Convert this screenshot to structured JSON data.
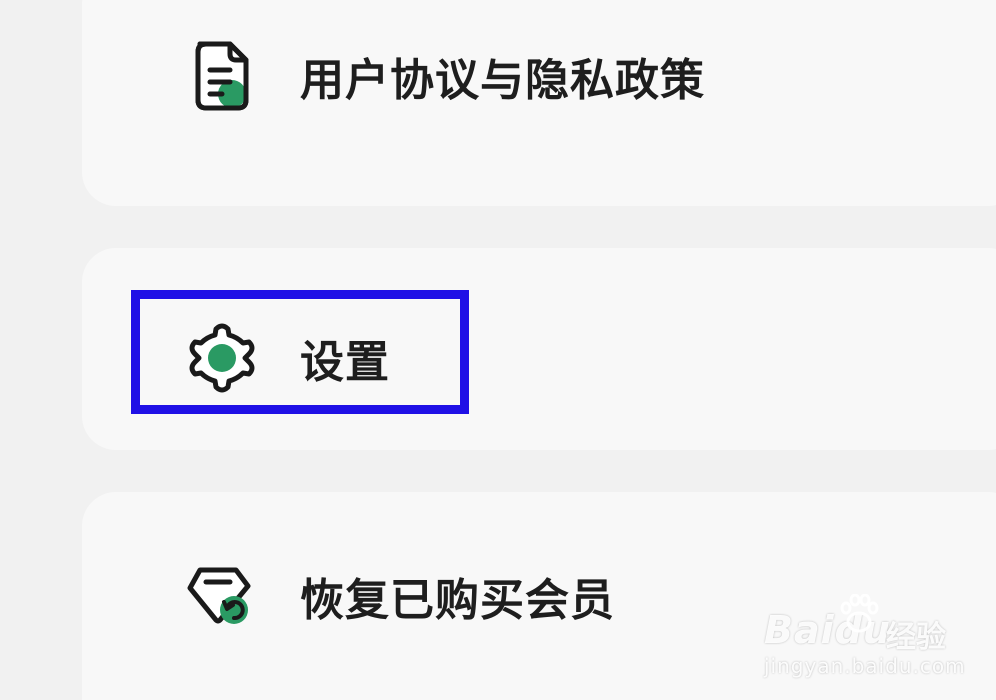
{
  "menu": {
    "items": [
      {
        "label": "用户协议与隐私政策",
        "icon": "document-icon"
      },
      {
        "label": "设置",
        "icon": "settings-gear-icon"
      },
      {
        "label": "恢复已购买会员",
        "icon": "restore-membership-icon"
      }
    ]
  },
  "colors": {
    "accent_green": "#2a9a63",
    "icon_stroke": "#1a1a1a",
    "highlight_blue": "#1f10e6",
    "card_bg": "#f8f8f8",
    "page_bg": "#f1f1f1"
  },
  "watermark": {
    "logo_text": "Baidu",
    "brand_cn": "经验",
    "url": "jingyan.baidu.com"
  }
}
